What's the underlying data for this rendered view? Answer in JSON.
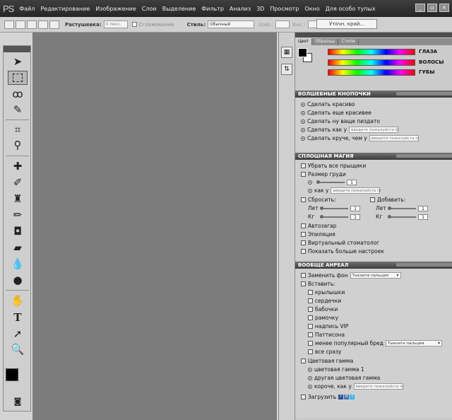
{
  "app": {
    "logo": "PS"
  },
  "menu": [
    "Файл",
    "Редактирование",
    "Изображение",
    "Слои",
    "Выделение",
    "Фильтр",
    "Анализ",
    "3D",
    "Просмотр",
    "Окно",
    "Для особо тупых"
  ],
  "options": {
    "feather_label": "Растушевка:",
    "feather_value": "0 пикс.",
    "antialias_label": "Сглаживание",
    "style_label": "Стиль:",
    "style_value": "Обычный",
    "width_label": "Шир.:",
    "height_label": "Выс.:",
    "refine_button": "Уточн. край..."
  },
  "color_panel": {
    "tabs": [
      "Цвет",
      "Образцы",
      "Стили"
    ],
    "sliders": [
      "ГЛАЗА",
      "ВОЛОСЫ",
      "ГУБЫ"
    ]
  },
  "magic_buttons": {
    "title": "ВОЛШЕБНЫЕ КНОПОЧКИ",
    "items": [
      "Сделать красиво",
      "Сделать еще красивее",
      "Сделать ну ваще пиздато",
      "Сделать как у",
      "Сделать круче, чем у"
    ],
    "placeholder": "введите пожалуйста id"
  },
  "solid_magic": {
    "title": "СПЛОШНАЯ МАГИЯ",
    "remove_pimples": "Убрать все прыщики",
    "breast_size": "Размер груди",
    "breast_value": "1",
    "like_label": "как у",
    "placeholder": "введите пожалуйста id",
    "reset_label": "Сбросить:",
    "add_label": "Добавить:",
    "years_label": "Лет",
    "kg_label": "Кг",
    "val": "1",
    "tan": "Автозагар",
    "epilation": "Эпиляция",
    "dentist": "Виртуальный стоматолог",
    "more": "Показать больше настроек"
  },
  "aureole": {
    "title": "ВООБЩЕ АНРЕАЛ",
    "replace_bg": "Заменить фон",
    "replace_value": "Тыкните пальцем",
    "insert_label": "Вставить:",
    "inserts": [
      "крылышки",
      "сердечки",
      "бабочки",
      "рамочку",
      "надпись VIP",
      "Паттисона"
    ],
    "less_popular": "менее популярный бред",
    "less_value": "Тыкните пальцем",
    "all_at_once": "все сразу",
    "color_scheme": "Цветовая гамма",
    "scheme1": "цветовая гамма 1",
    "scheme2": "другая цветовая гамма",
    "shorter": "короче, как у",
    "placeholder": "введите пожалуйста id",
    "upload": "Загрузить"
  },
  "colors": {
    "menubar": "#2d2d2d",
    "canvas": "#7c7c7c",
    "panel": "#cbcbcb"
  }
}
